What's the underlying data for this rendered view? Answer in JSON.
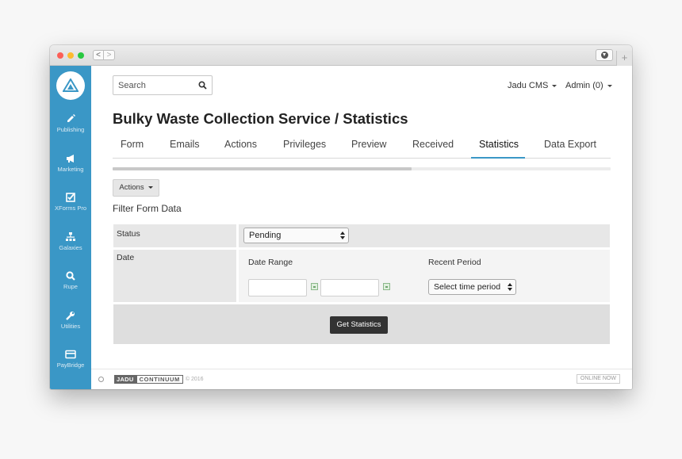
{
  "colors": {
    "sidebar": "#3a97c6",
    "accent": "#3a97c6",
    "primary_button": "#333333"
  },
  "browser": {
    "back_label": "<",
    "forward_label": ">",
    "new_tab_label": "+"
  },
  "sidebar": {
    "items": [
      {
        "label": "Publishing",
        "icon": "pencil-icon"
      },
      {
        "label": "Marketing",
        "icon": "megaphone-icon"
      },
      {
        "label": "XForms Pro",
        "icon": "checkbox-icon"
      },
      {
        "label": "Galaxies",
        "icon": "sitemap-icon"
      },
      {
        "label": "Rupe",
        "icon": "search-icon"
      },
      {
        "label": "Utilities",
        "icon": "wrench-icon"
      },
      {
        "label": "PayBridge",
        "icon": "credit-card-icon"
      }
    ]
  },
  "header": {
    "search_placeholder": "Search",
    "site_menu": "Jadu CMS",
    "user_menu": "Admin (0)"
  },
  "page": {
    "title": "Bulky Waste Collection Service / Statistics",
    "tabs": [
      {
        "label": "Form",
        "active": false
      },
      {
        "label": "Emails",
        "active": false
      },
      {
        "label": "Actions",
        "active": false
      },
      {
        "label": "Privileges",
        "active": false
      },
      {
        "label": "Preview",
        "active": false
      },
      {
        "label": "Received",
        "active": false
      },
      {
        "label": "Statistics",
        "active": true
      },
      {
        "label": "Data Export",
        "active": false
      }
    ],
    "progress_fraction": 0.6,
    "actions_label": "Actions",
    "filter_title": "Filter Form Data"
  },
  "filter": {
    "status_label": "Status",
    "status_value": "Pending",
    "date_label": "Date",
    "date_range_label": "Date Range",
    "recent_period_label": "Recent Period",
    "recent_period_value": "Select time period",
    "submit_label": "Get Statistics"
  },
  "footer": {
    "brand_left": "JADU",
    "brand_right": "CONTINUUM",
    "copyright": "© 2016",
    "status": "ONLINE NOW"
  }
}
